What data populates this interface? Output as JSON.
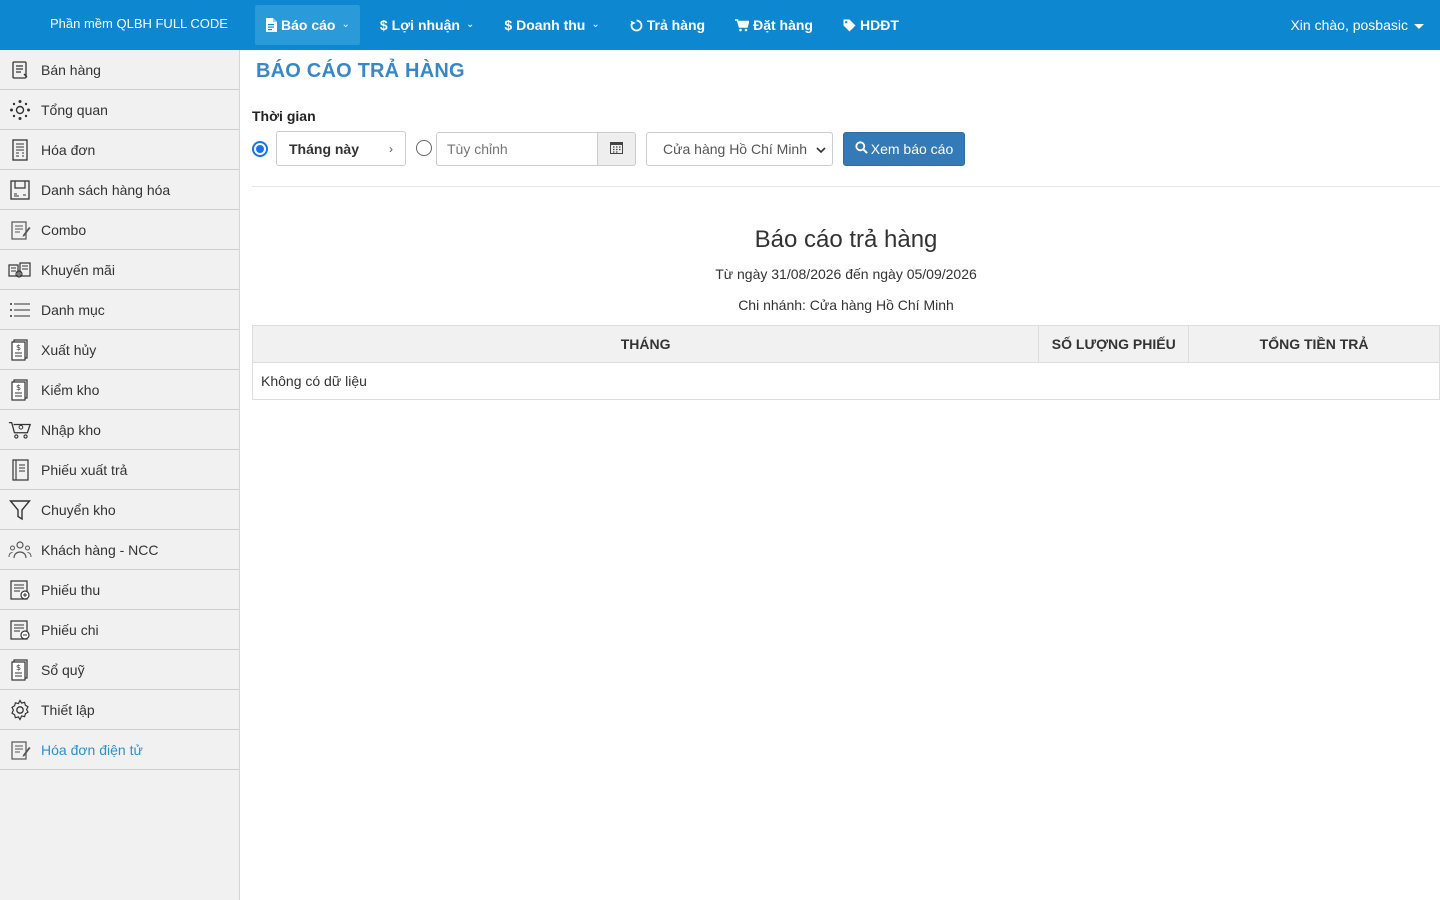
{
  "app": {
    "brand": "Phần mềm QLBH FULL CODE"
  },
  "nav": {
    "items": [
      {
        "label": "Báo cáo",
        "icon": "file-report-icon",
        "dropdown": true,
        "active": true
      },
      {
        "label": "Lợi nhuận",
        "icon": "dollar-icon",
        "dropdown": true
      },
      {
        "label": "Doanh thu",
        "icon": "dollar-icon",
        "dropdown": true
      },
      {
        "label": "Trả hàng",
        "icon": "undo-icon",
        "dropdown": false
      },
      {
        "label": "Đặt hàng",
        "icon": "cart-icon",
        "dropdown": false
      },
      {
        "label": "HDĐT",
        "icon": "tag-icon",
        "dropdown": false
      }
    ],
    "user_greeting": "Xin chào, posbasic"
  },
  "sidebar": {
    "items": [
      {
        "label": "Bán hàng",
        "icon": "sales-receipt-icon"
      },
      {
        "label": "Tổng quan",
        "icon": "overview-network-icon"
      },
      {
        "label": "Hóa đơn",
        "icon": "invoice-icon"
      },
      {
        "label": "Danh sách hàng hóa",
        "icon": "product-list-icon"
      },
      {
        "label": "Combo",
        "icon": "combo-edit-icon"
      },
      {
        "label": "Khuyến mãi",
        "icon": "promotion-icon"
      },
      {
        "label": "Danh mục",
        "icon": "list-lines-icon"
      },
      {
        "label": "Xuất hủy",
        "icon": "dollar-document-icon"
      },
      {
        "label": "Kiểm kho",
        "icon": "dollar-document-icon"
      },
      {
        "label": "Nhập kho",
        "icon": "shopping-cart-icon"
      },
      {
        "label": "Phiếu xuất trả",
        "icon": "ledger-icon"
      },
      {
        "label": "Chuyển kho",
        "icon": "funnel-icon"
      },
      {
        "label": "Khách hàng - NCC",
        "icon": "customers-group-icon"
      },
      {
        "label": "Phiếu thu",
        "icon": "receipt-in-icon"
      },
      {
        "label": "Phiếu chi",
        "icon": "receipt-out-icon"
      },
      {
        "label": "Sổ quỹ",
        "icon": "dollar-document-icon"
      },
      {
        "label": "Thiết lập",
        "icon": "gear-icon"
      },
      {
        "label": "Hóa đơn điện tử",
        "icon": "e-invoice-icon",
        "highlight": true
      }
    ]
  },
  "page": {
    "title": "BÁO CÁO TRẢ HÀNG",
    "filter_label": "Thời gian",
    "preset_value": "Tháng này",
    "custom_placeholder": "Tùy chỉnh",
    "branch_value": "Cửa hàng Hồ Chí Minh",
    "view_button": "Xem báo cáo"
  },
  "report": {
    "title": "Báo cáo trả hàng",
    "range": "Từ ngày 31/08/2026 đến ngày 05/09/2026",
    "branch": "Chi nhánh: Cửa hàng Hồ Chí Minh",
    "columns": [
      "THÁNG",
      "SỐ LƯỢNG PHIẾU",
      "TỔNG TIỀN TRẢ"
    ],
    "empty_text": "Không có dữ liệu"
  },
  "colors": {
    "navbar": "#0d87cf",
    "title": "#3a87c8",
    "button": "#337ab7",
    "sidebar": "#f1f1f1",
    "highlight_link": "#2f8ecf"
  }
}
